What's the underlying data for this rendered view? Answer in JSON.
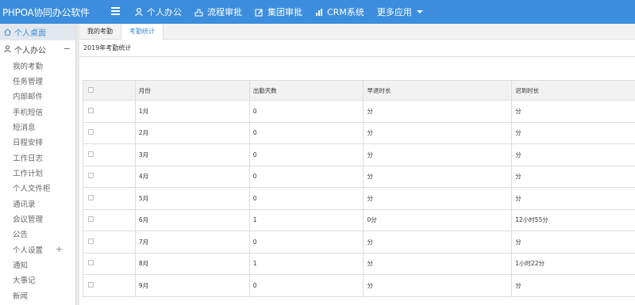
{
  "app": {
    "title": "PHPOA协同办公软件"
  },
  "topnav": [
    {
      "label": "个人办公",
      "icon": "user-icon"
    },
    {
      "label": "流程审批",
      "icon": "flow-icon"
    },
    {
      "label": "集团审批",
      "icon": "edit-icon"
    },
    {
      "label": "CRM系统",
      "icon": "bar-chart-icon"
    },
    {
      "label": "更多应用",
      "icon": "caret-down-icon"
    }
  ],
  "sidebar": {
    "home": "个人桌面",
    "group": "个人办公",
    "group_toggle": "−",
    "items": [
      {
        "label": "我的考勤"
      },
      {
        "label": "任务管理"
      },
      {
        "label": "内部邮件"
      },
      {
        "label": "手机短信"
      },
      {
        "label": "短消息"
      },
      {
        "label": "日程安排"
      },
      {
        "label": "工作日志"
      },
      {
        "label": "工作计划"
      },
      {
        "label": "个人文件柜"
      },
      {
        "label": "通讯录"
      },
      {
        "label": "会议管理"
      },
      {
        "label": "公告"
      },
      {
        "label": "个人设置",
        "toggle": "+"
      },
      {
        "label": "通知"
      },
      {
        "label": "大事记"
      },
      {
        "label": "新闻"
      }
    ]
  },
  "tabs": [
    {
      "label": "我的考勤",
      "active": false
    },
    {
      "label": "考勤统计",
      "active": true
    }
  ],
  "section_title": "2019年考勤统计",
  "table": {
    "headers": [
      "月份",
      "出勤天数",
      "早退时长",
      "迟到时长"
    ],
    "rows": [
      [
        "1月",
        "0",
        "分",
        "分"
      ],
      [
        "2月",
        "0",
        "分",
        "分"
      ],
      [
        "3月",
        "0",
        "分",
        "分"
      ],
      [
        "4月",
        "0",
        "分",
        "分"
      ],
      [
        "5月",
        "0",
        "分",
        "分"
      ],
      [
        "6月",
        "1",
        "0分",
        "12小时55分"
      ],
      [
        "7月",
        "0",
        "分",
        "分"
      ],
      [
        "8月",
        "1",
        "分",
        "1小时22分"
      ],
      [
        "9月",
        "0",
        "分",
        "分"
      ]
    ]
  },
  "colors": {
    "brand": "#3c8dde",
    "header_bg": "#f2f2f2"
  }
}
